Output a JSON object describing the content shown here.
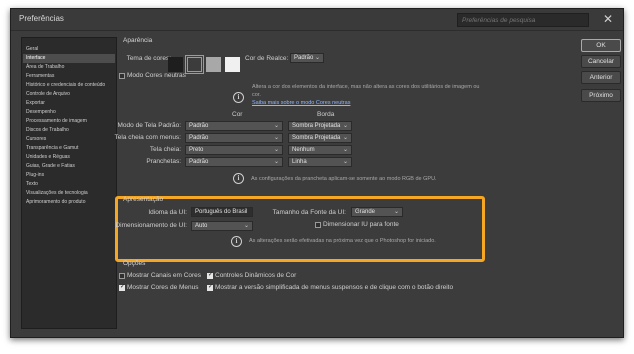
{
  "window": {
    "title": "Preferências",
    "search_placeholder": "Preferências de pesquisa",
    "close_glyph": "✕"
  },
  "sidebar": {
    "items": [
      {
        "label": "Geral",
        "active": false
      },
      {
        "label": "Interface",
        "active": true
      },
      {
        "label": "Área de Trabalho",
        "active": false
      },
      {
        "label": "Ferramentas",
        "active": false
      },
      {
        "label": "Histórico e credenciais de conteúdo",
        "active": false
      },
      {
        "label": "Controle de Arquivo",
        "active": false
      },
      {
        "label": "Exportar",
        "active": false
      },
      {
        "label": "Desempenho",
        "active": false
      },
      {
        "label": "Processamento de imagem",
        "active": false
      },
      {
        "label": "Discos de Trabalho",
        "active": false
      },
      {
        "label": "Cursores",
        "active": false
      },
      {
        "label": "Transparência e Gamut",
        "active": false
      },
      {
        "label": "Unidades e Réguas",
        "active": false
      },
      {
        "label": "Guias, Grade e Fatias",
        "active": false
      },
      {
        "label": "Plug-ins",
        "active": false
      },
      {
        "label": "Texto",
        "active": false
      },
      {
        "label": "Visualizações de tecnologia",
        "active": false
      },
      {
        "label": "Aprimoramento do produto",
        "active": false
      }
    ]
  },
  "aparencia": {
    "heading": "Aparência",
    "color_theme_label": "Tema de cores:",
    "swatch_colors": [
      "#1e1e1e",
      "#3c3c3c",
      "#a8a8a8",
      "#f0f0f0"
    ],
    "selected_swatch": 1,
    "highlight_color_label": "Cor de Realce:",
    "highlight_color_value": "Padrão",
    "neutral_colors_label": "Modo Cores neutras",
    "neutral_colors_checked": false,
    "info_text": "Altera a cor dos elementos da interface, mas não altera as cores dos utilitários de imagem ou cor.",
    "info_link": "Saiba mais sobre o modo Cores neutras",
    "col_cor": "Cor",
    "col_borda": "Borda",
    "rows": [
      {
        "label": "Modo de Tela Padrão:",
        "cor": "Padrão",
        "borda": "Sombra Projetada"
      },
      {
        "label": "Tela cheia com menus:",
        "cor": "Padrão",
        "borda": "Sombra Projetada"
      },
      {
        "label": "Tela cheia:",
        "cor": "Preto",
        "borda": "Nenhum"
      },
      {
        "label": "Pranchetas:",
        "cor": "Padrão",
        "borda": "Linha"
      }
    ],
    "artboard_note": "As configurações da prancheta aplicam-se somente ao modo RGB de GPU."
  },
  "apresentacao": {
    "heading": "Apresentação",
    "ui_language_label": "Idioma da UI:",
    "ui_language_value": "Português do Brasil",
    "ui_font_size_label": "Tamanho da Fonte da UI:",
    "ui_font_size_value": "Grande",
    "ui_scaling_label": "Dimensionamento de UI:",
    "ui_scaling_value": "Auto",
    "scale_ui_to_font_label": "Dimensionar IU para fonte",
    "scale_ui_to_font_checked": false,
    "note": "As alterações serão efetivadas na próxima vez que o Photoshop for iniciado."
  },
  "opcoes": {
    "heading": "Opções",
    "items": [
      {
        "label": "Mostrar Canais em Cores",
        "checked": false
      },
      {
        "label": "Controles Dinâmicos de Cor",
        "checked": true
      },
      {
        "label": "Mostrar Cores de Menus",
        "checked": true
      },
      {
        "label": "Mostrar a versão simplificada de menus suspensos e de clique com o botão direito",
        "checked": true
      }
    ]
  },
  "buttons": {
    "ok": "OK",
    "cancel": "Cancelar",
    "prev": "Anterior",
    "next": "Próximo"
  },
  "colors": {
    "highlight_box": "#f5a623",
    "window_bg": "#3c3c3c",
    "link": "#8fb7ff"
  }
}
